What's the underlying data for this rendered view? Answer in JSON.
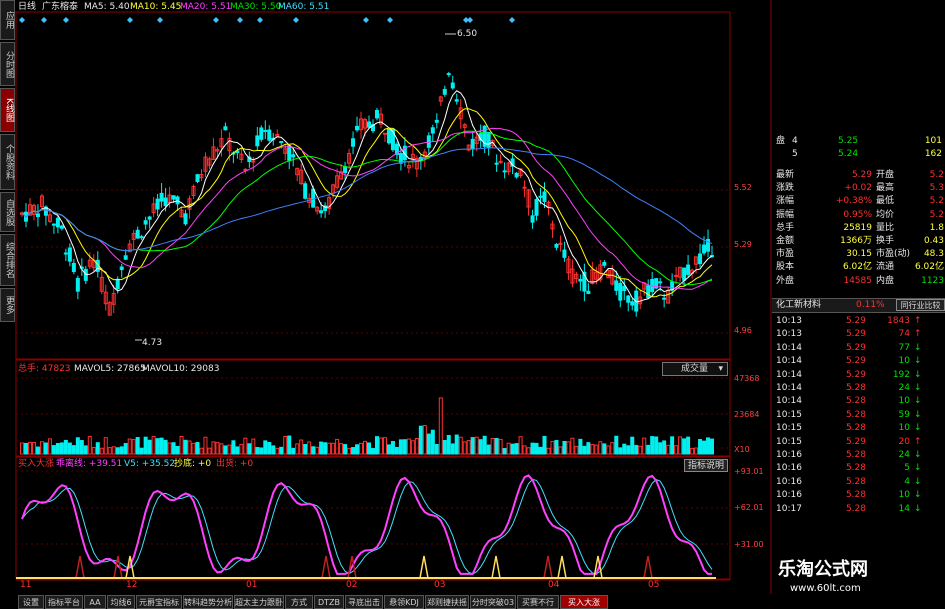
{
  "side_tabs": [
    {
      "label": "应用"
    },
    {
      "label": "分时图"
    },
    {
      "label": "K线图"
    },
    {
      "label": "个股资料"
    },
    {
      "label": "自选股"
    },
    {
      "label": "综合排名"
    },
    {
      "label": "更多"
    }
  ],
  "top_bar": {
    "period": "日线",
    "stock": "广东榕泰",
    "ma5": "MA5: 5.40",
    "ma10": "MA10: 5.45",
    "ma20": "MA20: 5.51",
    "ma30": "MA30: 5.50",
    "ma60": "MA60: 5.51"
  },
  "price_axis": {
    "ticks": [
      "5.52",
      "5.29",
      "4.96"
    ],
    "high_label": "6.50",
    "low_label": "4.73"
  },
  "volume_bar": {
    "label_total": "总手: 47823",
    "mavol5": "MAVOL5: 27865",
    "mavol10": "MAVOL10: 29083",
    "dropdown": "成交量",
    "ticks": [
      "47368",
      "23684",
      "X10"
    ]
  },
  "indicator_bar": {
    "name": "买入大涨",
    "l1": "乖离线: +39.51",
    "l2": "V5: +35.52",
    "l3": "抄底: +0",
    "l4": "出货: +0",
    "button": "指标说明",
    "ticks": [
      "+93.01",
      "+62.01",
      "+31.00"
    ]
  },
  "x_axis_months": [
    "11",
    "12",
    "01",
    "02",
    "03",
    "04",
    "05"
  ],
  "quote": {
    "rows_top": [
      {
        "label": "盘",
        "lv": "4",
        "price": "5.25",
        "vol": "101"
      },
      {
        "label": "",
        "lv": "5",
        "price": "5.24",
        "vol": "162"
      }
    ],
    "fields": [
      {
        "k": "最新",
        "v": "5.29",
        "k2": "开盘",
        "v2": "5.2"
      },
      {
        "k": "涨跌",
        "v": "+0.02",
        "k2": "最高",
        "v2": "5.3"
      },
      {
        "k": "涨幅",
        "v": "+0.38%",
        "k2": "最低",
        "v2": "5.2"
      },
      {
        "k": "振幅",
        "v": "0.95%",
        "k2": "均价",
        "v2": "5.2"
      },
      {
        "k": "总手",
        "v": "25819",
        "k2": "量比",
        "v2": "1.8"
      },
      {
        "k": "金额",
        "v": "1366万",
        "k2": "换手",
        "v2": "0.43"
      },
      {
        "k": "市盈",
        "v": "30.15",
        "k2": "市盈(动)",
        "v2": "48.3"
      },
      {
        "k": "股本",
        "v": "6.02亿",
        "k2": "流通",
        "v2": "6.02亿"
      },
      {
        "k": "外盘",
        "v": "14585",
        "k2": "内盘",
        "v2": "1123"
      }
    ],
    "industry": {
      "name": "化工新材料",
      "pct": "0.11%",
      "button": "同行业比较"
    },
    "ticks": [
      {
        "time": "10:13",
        "price": "5.29",
        "vol": "1843",
        "dir": "up"
      },
      {
        "time": "10:13",
        "price": "5.29",
        "vol": "74",
        "dir": "up"
      },
      {
        "time": "10:14",
        "price": "5.29",
        "vol": "77",
        "dir": "down"
      },
      {
        "time": "10:14",
        "price": "5.29",
        "vol": "10",
        "dir": "down"
      },
      {
        "time": "10:14",
        "price": "5.29",
        "vol": "192",
        "dir": "down"
      },
      {
        "time": "10:14",
        "price": "5.28",
        "vol": "24",
        "dir": "down"
      },
      {
        "time": "10:14",
        "price": "5.28",
        "vol": "10",
        "dir": "down"
      },
      {
        "time": "10:15",
        "price": "5.28",
        "vol": "59",
        "dir": "down"
      },
      {
        "time": "10:15",
        "price": "5.28",
        "vol": "10",
        "dir": "down"
      },
      {
        "time": "10:15",
        "price": "5.29",
        "vol": "20",
        "dir": "up"
      },
      {
        "time": "10:16",
        "price": "5.28",
        "vol": "24",
        "dir": "down"
      },
      {
        "time": "10:16",
        "price": "5.28",
        "vol": "5",
        "dir": "down"
      },
      {
        "time": "10:16",
        "price": "5.28",
        "vol": "4",
        "dir": "down"
      },
      {
        "time": "10:16",
        "price": "5.28",
        "vol": "10",
        "dir": "down"
      },
      {
        "time": "10:17",
        "price": "5.28",
        "vol": "14",
        "dir": "down"
      }
    ]
  },
  "watermark": {
    "line1": "乐淘公式网",
    "line2": "www.60lt.com"
  },
  "bottom_tabs": [
    "设置",
    "指标平台",
    "AA",
    "均线6",
    "元爵宝指标",
    "转科趋势分析",
    "超太主力跟卧",
    "方式",
    "DTZB",
    "寻底出击",
    "悬领KDJ",
    "郑则捷扶摇",
    "分时突破03",
    "买赛不行",
    "买入大涨"
  ],
  "colors": {
    "up": "#ff3030",
    "down": "#00f0f0",
    "grid": "#8a0000",
    "ma5": "#ffffff",
    "ma10": "#ffff00",
    "ma20": "#ff40ff",
    "ma30": "#00ff00",
    "ma60": "#4080ff"
  }
}
